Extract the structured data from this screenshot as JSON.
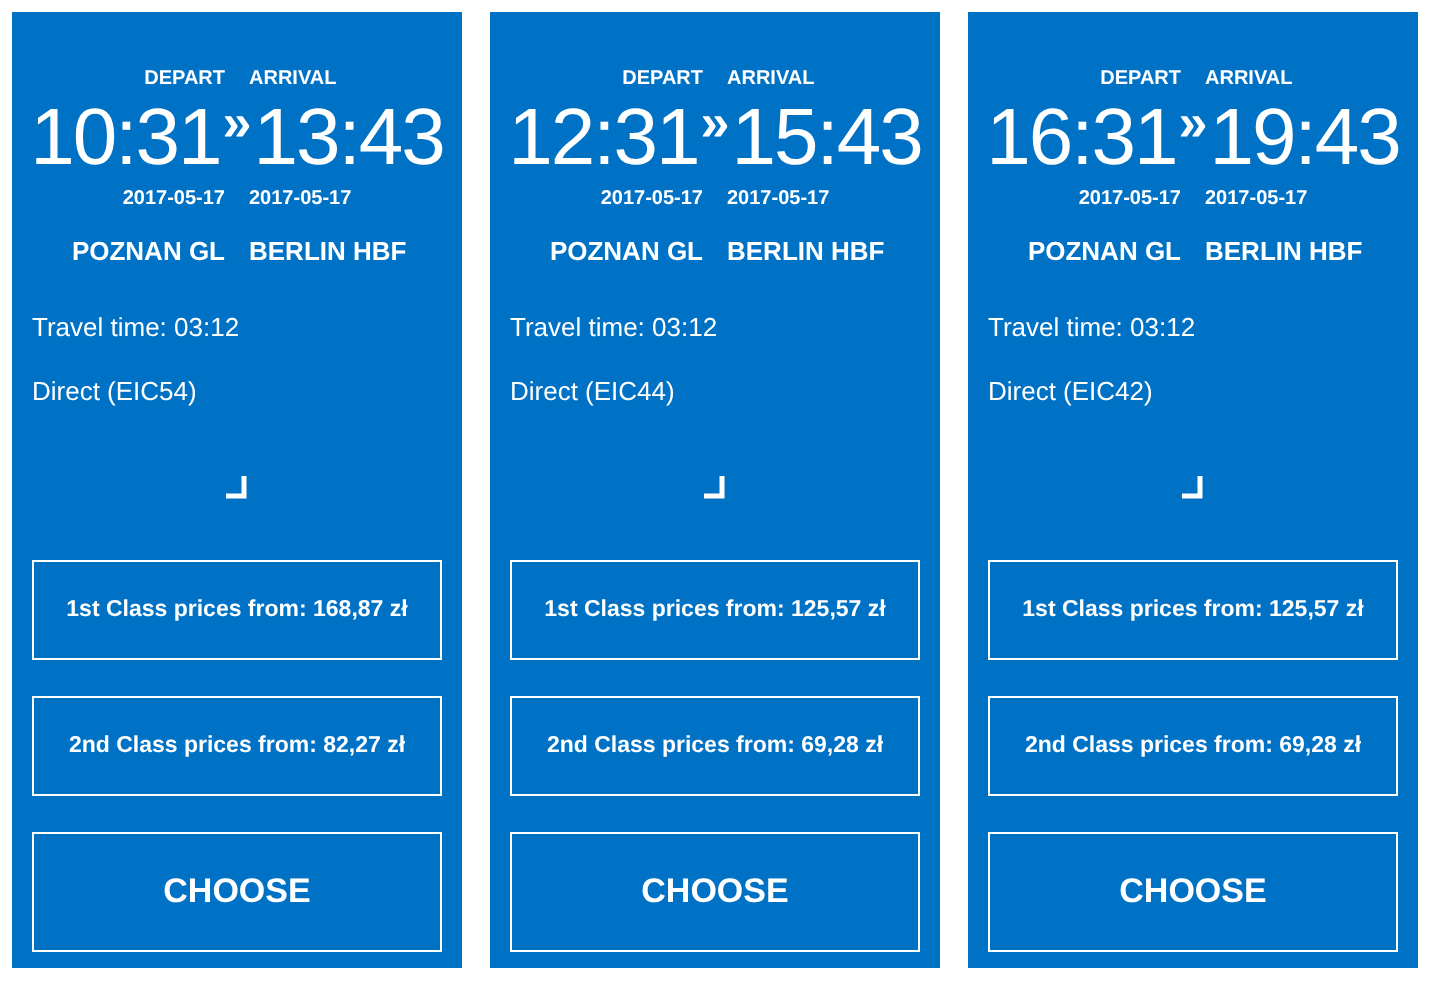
{
  "cards": [
    {
      "depart_label": "DEPART",
      "arrival_label": "ARRIVAL",
      "depart_time": "10:31",
      "separator": "»",
      "arrival_time": "13:43",
      "depart_date": "2017-05-17",
      "arrival_date": "2017-05-17",
      "from": "POZNAN GL",
      "to": "BERLIN HBF",
      "travel_time": "Travel time: 03:12",
      "connection": "Direct (EIC54)",
      "prices": [
        "1st Class prices from: 168,87 zł",
        "2nd Class prices from: 82,27 zł"
      ],
      "action": "CHOOSE"
    },
    {
      "depart_label": "DEPART",
      "arrival_label": "ARRIVAL",
      "depart_time": "12:31",
      "separator": "»",
      "arrival_time": "15:43",
      "depart_date": "2017-05-17",
      "arrival_date": "2017-05-17",
      "from": "POZNAN GL",
      "to": "BERLIN HBF",
      "travel_time": "Travel time: 03:12",
      "connection": "Direct (EIC44)",
      "prices": [
        "1st Class prices from: 125,57 zł",
        "2nd Class prices from: 69,28 zł"
      ],
      "action": "CHOOSE"
    },
    {
      "depart_label": "DEPART",
      "arrival_label": "ARRIVAL",
      "depart_time": "16:31",
      "separator": "»",
      "arrival_time": "19:43",
      "depart_date": "2017-05-17",
      "arrival_date": "2017-05-17",
      "from": "POZNAN GL",
      "to": "BERLIN HBF",
      "travel_time": "Travel time: 03:12",
      "connection": "Direct (EIC42)",
      "prices": [
        "1st Class prices from: 125,57 zł",
        "2nd Class prices from: 69,28 zł"
      ],
      "action": "CHOOSE"
    }
  ]
}
